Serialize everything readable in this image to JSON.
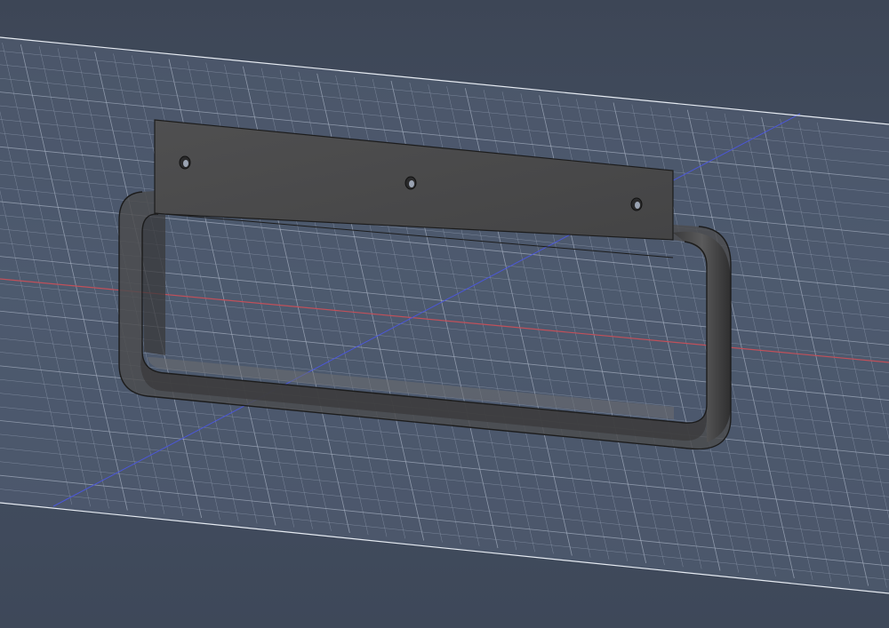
{
  "viewport": {
    "background_color": "#3f4857",
    "grid_fill_color": "#566378",
    "grid_line_color": "#8d99ad",
    "grid_major_color": "#aab4c4",
    "grid_edge_color": "#e6ebf2",
    "x_axis_color": "#c0505a",
    "y_axis_color": "#4b57d8"
  },
  "model": {
    "name": "towel-bar-bracket",
    "body_color": "#4c4c4d",
    "edge_color": "#1c1c1c",
    "highlight_color": "#6e6e70",
    "hole_count": 3
  }
}
